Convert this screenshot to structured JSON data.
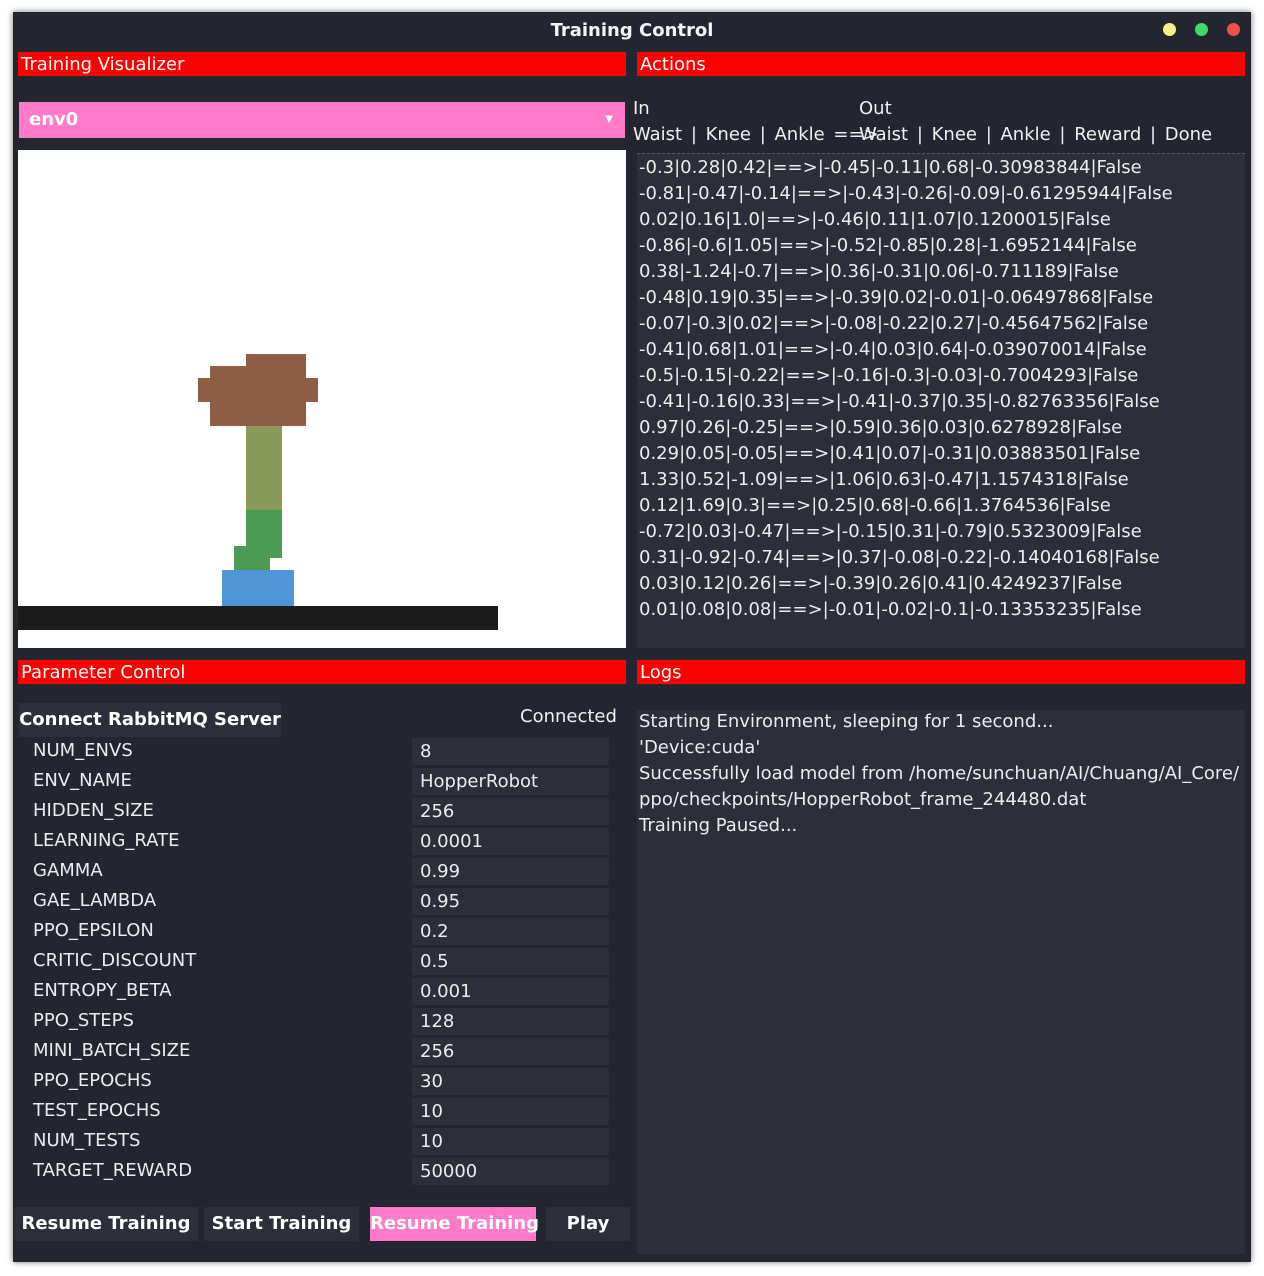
{
  "window": {
    "title": "Training Control"
  },
  "sections": {
    "visualizer": "Training Visualizer",
    "actions": "Actions",
    "parameters": "Parameter Control",
    "logs": "Logs"
  },
  "visualizer": {
    "env_selected": "env0",
    "dropdown_icon": "caret-down-icon"
  },
  "actions": {
    "header_in": "In",
    "header_out": "Out",
    "columns_in": "Waist | Knee | Ankle ==>",
    "columns_out": "Waist | Knee | Ankle | Reward | Done",
    "rows": [
      "-0.3|0.28|0.42|==>|-0.45|-0.11|0.68|-0.30983844|False",
      "-0.81|-0.47|-0.14|==>|-0.43|-0.26|-0.09|-0.61295944|False",
      "0.02|0.16|1.0|==>|-0.46|0.11|1.07|0.1200015|False",
      "-0.86|-0.6|1.05|==>|-0.52|-0.85|0.28|-1.6952144|False",
      "0.38|-1.24|-0.7|==>|0.36|-0.31|0.06|-0.711189|False",
      "-0.48|0.19|0.35|==>|-0.39|0.02|-0.01|-0.06497868|False",
      "-0.07|-0.3|0.02|==>|-0.08|-0.22|0.27|-0.45647562|False",
      "-0.41|0.68|1.01|==>|-0.4|0.03|0.64|-0.039070014|False",
      "-0.5|-0.15|-0.22|==>|-0.16|-0.3|-0.03|-0.7004293|False",
      "-0.41|-0.16|0.33|==>|-0.41|-0.37|0.35|-0.82763356|False",
      "0.97|0.26|-0.25|==>|0.59|0.36|0.03|0.6278928|False",
      "0.29|0.05|-0.05|==>|0.41|0.07|-0.31|0.03883501|False",
      "1.33|0.52|-1.09|==>|1.06|0.63|-0.47|1.1574318|False",
      "0.12|1.69|0.3|==>|0.25|0.68|-0.66|1.3764536|False",
      "-0.72|0.03|-0.47|==>|-0.15|0.31|-0.79|0.5323009|False",
      "0.31|-0.92|-0.74|==>|0.37|-0.08|-0.22|-0.14040168|False",
      "0.03|0.12|0.26|==>|-0.39|0.26|0.41|0.4249237|False",
      "0.01|0.08|0.08|==>|-0.01|-0.02|-0.1|-0.13353235|False"
    ]
  },
  "parameters": {
    "connect_button": "Connect RabbitMQ Server",
    "status": "Connected",
    "items": [
      {
        "name": "NUM_ENVS",
        "value": "8"
      },
      {
        "name": "ENV_NAME",
        "value": "HopperRobot"
      },
      {
        "name": "HIDDEN_SIZE",
        "value": "256"
      },
      {
        "name": "LEARNING_RATE",
        "value": "0.0001"
      },
      {
        "name": "GAMMA",
        "value": "0.99"
      },
      {
        "name": "GAE_LAMBDA",
        "value": "0.95"
      },
      {
        "name": "PPO_EPSILON",
        "value": "0.2"
      },
      {
        "name": "CRITIC_DISCOUNT",
        "value": "0.5"
      },
      {
        "name": "ENTROPY_BETA",
        "value": "0.001"
      },
      {
        "name": "PPO_STEPS",
        "value": "128"
      },
      {
        "name": "MINI_BATCH_SIZE",
        "value": "256"
      },
      {
        "name": "PPO_EPOCHS",
        "value": "30"
      },
      {
        "name": "TEST_EPOCHS",
        "value": "10"
      },
      {
        "name": "NUM_TESTS",
        "value": "10"
      },
      {
        "name": "TARGET_REWARD",
        "value": "50000"
      }
    ]
  },
  "buttons": {
    "resume_training_1": "Resume Training",
    "start_training": "Start Training",
    "resume_training_2": "Resume Training",
    "play": "Play"
  },
  "logs": {
    "lines": [
      "Starting Environment, sleeping for 1 second...",
      "'Device:cuda'",
      "Successfully load model from /home/sunchuan/AI/Chuang/AI_Core/",
      "ppo/checkpoints/HopperRobot_frame_244480.dat",
      "Training Paused..."
    ]
  },
  "colors": {
    "background": "#232530",
    "section_header": "#ff0000",
    "accent_pink": "#ff7ac8",
    "panel": "#2c2f39",
    "robot_head": "#8c5e45",
    "robot_thigh": "#8a9a5b",
    "robot_shin": "#4d9a55",
    "robot_foot": "#4f95d6",
    "ground": "#1b1b1b"
  }
}
